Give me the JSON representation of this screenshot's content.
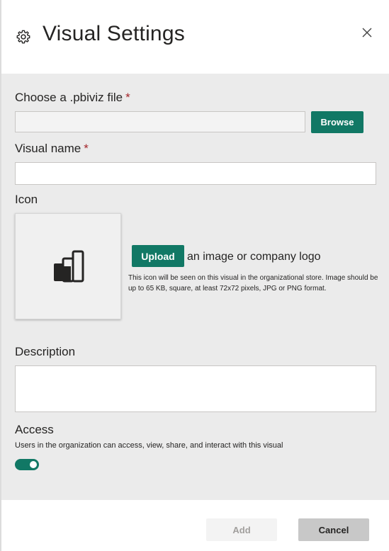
{
  "header": {
    "icon": "gear-icon",
    "title": "Visual Settings",
    "close_icon": "close-icon"
  },
  "form": {
    "file": {
      "label": "Choose a .pbiviz file",
      "required_mark": "*",
      "value": "",
      "browse_label": "Browse"
    },
    "name": {
      "label": "Visual name",
      "required_mark": "*",
      "value": ""
    },
    "icon": {
      "label": "Icon",
      "preview_icon": "visual-placeholder-icon",
      "upload_label": "Upload",
      "upload_suffix": "an image or company logo",
      "hint": "This icon will be seen on this visual in the organizational store. Image should be up to 65 KB, square, at least 72x72 pixels, JPG or PNG format."
    },
    "description": {
      "label": "Description",
      "value": ""
    },
    "access": {
      "label": "Access",
      "description": "Users in the organization can access, view, share, and interact with this visual",
      "enabled": true
    }
  },
  "footer": {
    "add_label": "Add",
    "cancel_label": "Cancel"
  },
  "colors": {
    "accent": "#117865",
    "required": "#a4262c",
    "body_bg": "#ebebeb"
  }
}
